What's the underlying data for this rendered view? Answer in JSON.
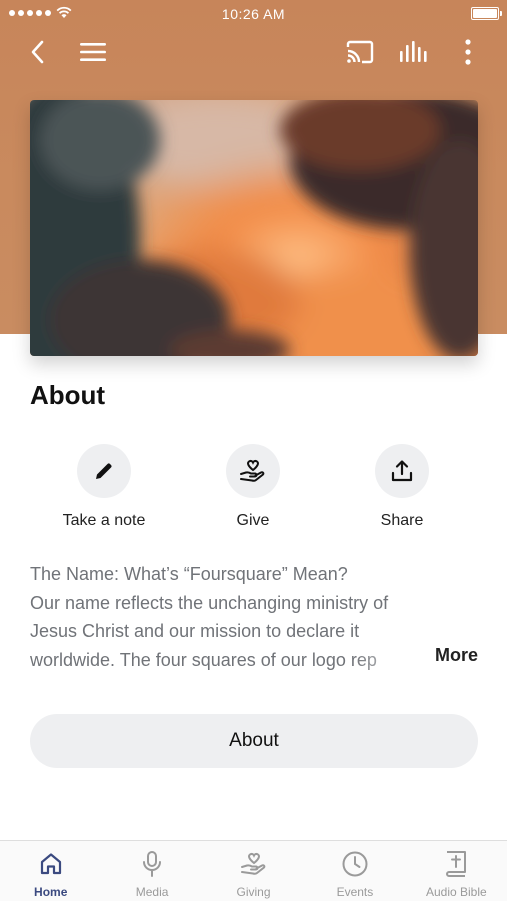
{
  "status_bar": {
    "time": "10:26 AM"
  },
  "nav": {
    "back_icon": "chevron-left-icon",
    "menu_icon": "hamburger-menu-icon",
    "cast_icon": "cast-icon",
    "audio_icon": "audio-bars-icon",
    "more_icon": "more-vertical-icon"
  },
  "hero": {
    "image": "sunset clouds photo"
  },
  "section": {
    "title": "About"
  },
  "actions": [
    {
      "label": "Take a note",
      "icon": "pencil-icon"
    },
    {
      "label": "Give",
      "icon": "heart-hand-icon"
    },
    {
      "label": "Share",
      "icon": "share-upload-icon"
    }
  ],
  "description": {
    "lines": [
      "The Name: What’s “Foursquare” Mean?",
      "Our name reflects the unchanging ministry of",
      "Jesus Christ and our mission to declare it",
      "worldwide. The four squares of our logo rep"
    ],
    "more_label": "More"
  },
  "about_button": {
    "label": "About"
  },
  "tab_bar": {
    "tabs": [
      {
        "label": "Home",
        "icon": "home-icon",
        "active": true
      },
      {
        "label": "Media",
        "icon": "microphone-icon",
        "active": false
      },
      {
        "label": "Giving",
        "icon": "heart-hand-icon",
        "active": false
      },
      {
        "label": "Events",
        "icon": "clock-icon",
        "active": false
      },
      {
        "label": "Audio Bible",
        "icon": "bible-icon",
        "active": false
      }
    ]
  },
  "colors": {
    "header_bg": "#c98a5e",
    "button_bg": "#eeeff1",
    "active_tab": "#3b4a80",
    "inactive_tab": "#9a9a9a",
    "body_text": "#707378"
  }
}
